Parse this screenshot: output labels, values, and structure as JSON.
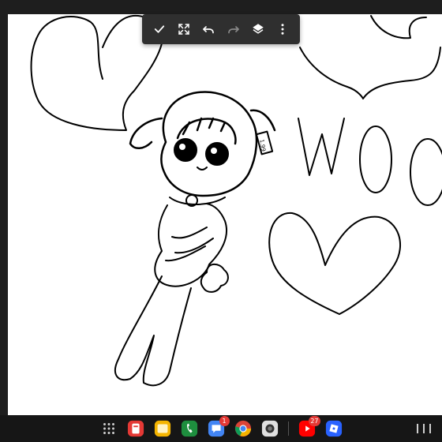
{
  "canvas": {
    "handwritten_text": "WOO",
    "tag_text": "1.99"
  },
  "toolbar": {
    "buttons": [
      {
        "name": "confirm",
        "icon": "check-icon"
      },
      {
        "name": "fit-screen",
        "icon": "expand-icon"
      },
      {
        "name": "undo",
        "icon": "undo-icon"
      },
      {
        "name": "redo",
        "icon": "redo-icon"
      },
      {
        "name": "layers",
        "icon": "layers-icon"
      },
      {
        "name": "more",
        "icon": "more-vert-icon"
      }
    ]
  },
  "taskbar": {
    "apps": [
      {
        "name": "app-drawer",
        "icon": "grid-icon"
      },
      {
        "name": "phone-app-red",
        "icon": "red-app-icon"
      },
      {
        "name": "notes",
        "icon": "notes-icon"
      },
      {
        "name": "phone",
        "icon": "phone-icon"
      },
      {
        "name": "messages",
        "icon": "chat-icon",
        "badge": "1"
      },
      {
        "name": "chrome",
        "icon": "chrome-icon"
      },
      {
        "name": "camera",
        "icon": "camera-icon"
      },
      {
        "name": "youtube",
        "icon": "youtube-icon",
        "badge": "27"
      },
      {
        "name": "roblox",
        "icon": "roblox-icon"
      }
    ]
  },
  "colors": {
    "toolbar_bg": "#2f2f2f",
    "canvas_bg": "#ffffff",
    "ink": "#000000",
    "frame": "#1e1e1e"
  }
}
